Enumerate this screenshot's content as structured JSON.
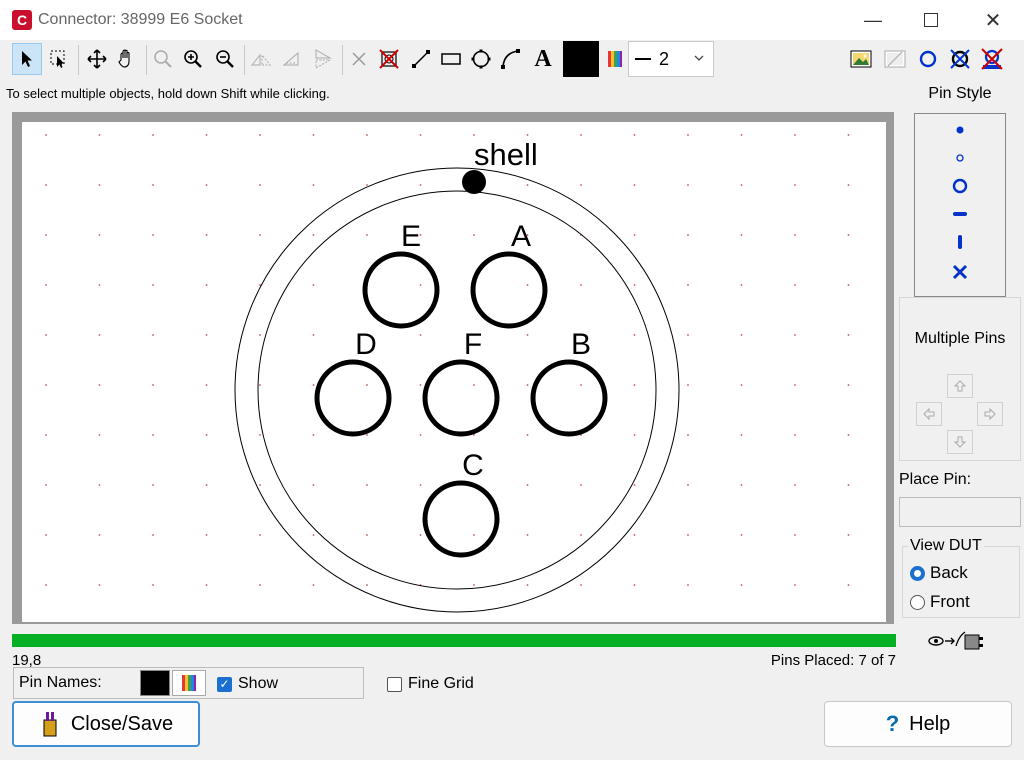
{
  "window": {
    "title": "Connector: 38999 E6 Socket",
    "app_icon_letter": "C",
    "controls": [
      "minimize",
      "maximize",
      "close"
    ]
  },
  "toolbar": {
    "line_width": "2",
    "text_tool_glyph": "A"
  },
  "hint": "To select multiple objects, hold down Shift while clicking.",
  "canvas": {
    "shell_label": "shell",
    "pins": [
      {
        "name": "E"
      },
      {
        "name": "A"
      },
      {
        "name": "D"
      },
      {
        "name": "F"
      },
      {
        "name": "B"
      },
      {
        "name": "C"
      }
    ]
  },
  "status": {
    "coords": "19,8",
    "pins_placed": "Pins Placed: 7 of 7",
    "progress_fraction": 1.0
  },
  "pin_names": {
    "label": "Pin Names:",
    "show_label": "Show",
    "show_checked": true
  },
  "fine_grid": {
    "label": "Fine Grid",
    "checked": false
  },
  "right_panel": {
    "pin_style_title": "Pin Style",
    "multiple_pins_title": "Multiple Pins",
    "place_pin_label": "Place Pin:",
    "place_pin_value": "",
    "view_dut_title": "View DUT",
    "view_back": "Back",
    "view_front": "Front",
    "view_selected": "Back"
  },
  "buttons": {
    "close_save": "Close/Save",
    "help": "Help",
    "help_glyph": "?"
  },
  "colors": {
    "accent": "#1a6fd0",
    "progress": "#06b025",
    "pin_style_blue": "#0033cc",
    "red": "#d00000"
  }
}
